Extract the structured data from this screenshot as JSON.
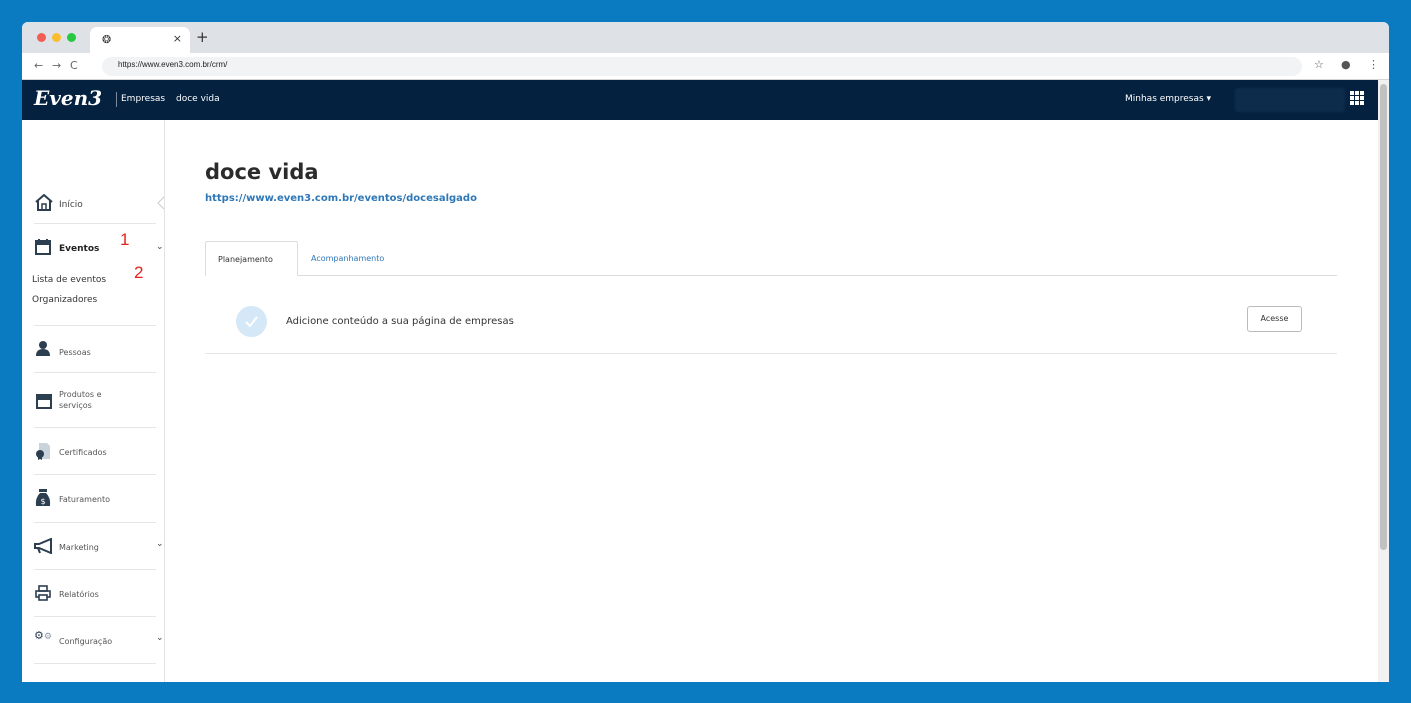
{
  "browser": {
    "tab_favicon": "github-like-icon",
    "tab_close": "×",
    "new_tab": "+",
    "url": "https://www.even3.com.br/crm/"
  },
  "header": {
    "logo": "Even3",
    "section": "Empresas",
    "company": "doce vida",
    "menu": "Minhas empresas ▾"
  },
  "sidebar": {
    "inicio": "Início",
    "eventos": "Eventos",
    "eventos_sub": [
      "Lista de eventos",
      "Organizadores"
    ],
    "pessoas": "Pessoas",
    "produtos_line1": "Produtos e",
    "produtos_line2": "serviços",
    "certificados": "Certificados",
    "faturamento": "Faturamento",
    "marketing": "Marketing",
    "relatorios": "Relatórios",
    "configuracao": "Configuração",
    "annotation_1": "1",
    "annotation_2": "2"
  },
  "main": {
    "title": "doce vida",
    "link": "https://www.even3.com.br/eventos/docesalgado",
    "tabs": [
      "Planejamento",
      "Acompanhamento"
    ],
    "task_text": "Adicione conteúdo a sua página de empresas",
    "task_button": "Acesse"
  },
  "colors": {
    "background": "#0a7bc1",
    "header": "#04213f",
    "link": "#2f78b8",
    "annotation": "#e8231c"
  }
}
